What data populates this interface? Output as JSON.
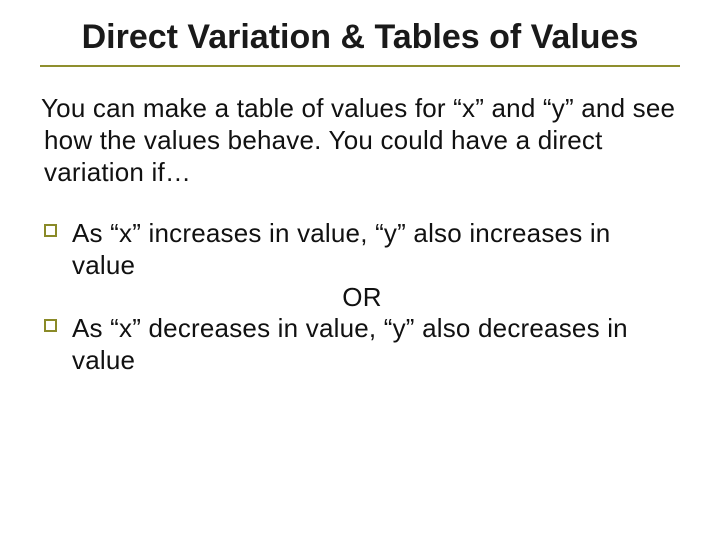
{
  "title": "Direct Variation & Tables of Values",
  "intro": "You can make a table of values for “x” and “y” and see how the values behave. You could have a direct variation if…",
  "bullets": {
    "item1": "As “x” increases in value, “y” also increases in value",
    "or": "OR",
    "item2": "As “x” decreases in value, “y” also decreases in value"
  }
}
